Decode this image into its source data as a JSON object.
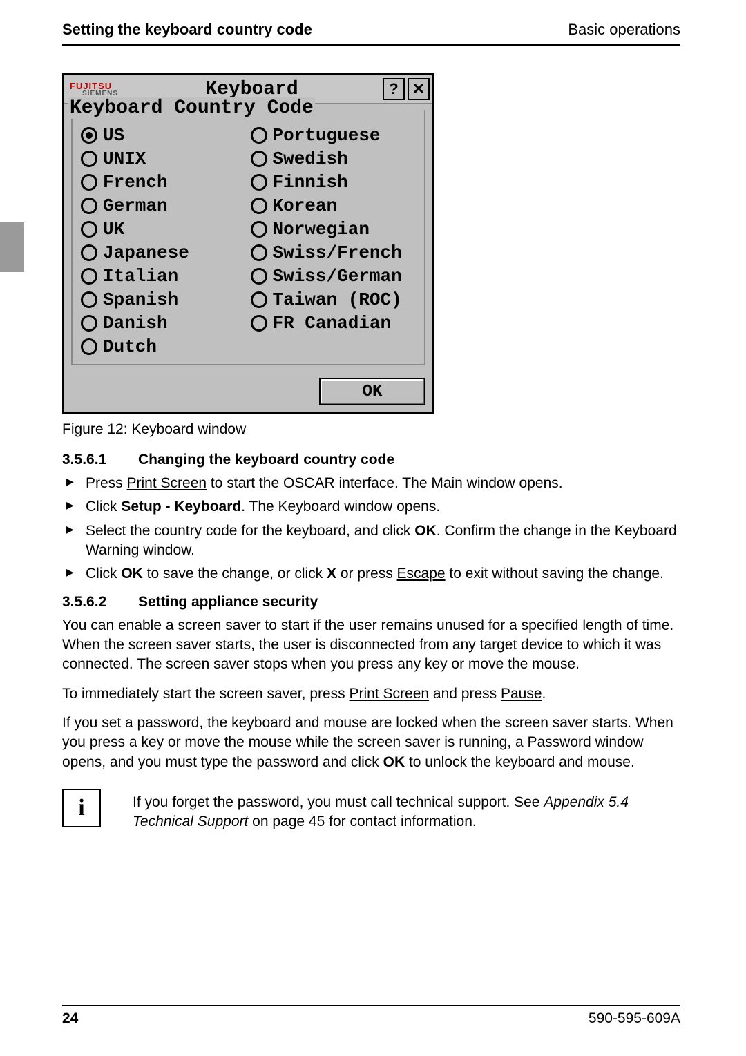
{
  "header": {
    "left": "Setting the keyboard country code",
    "right": "Basic operations"
  },
  "window": {
    "logo_top": "FUJITSU",
    "logo_bot": "SIEMENS",
    "title": "Keyboard",
    "help_btn": "?",
    "close_btn": "✕",
    "group_label": "Keyboard Country Code",
    "col1": [
      {
        "label": "US",
        "checked": true
      },
      {
        "label": "UNIX",
        "checked": false
      },
      {
        "label": "French",
        "checked": false
      },
      {
        "label": "German",
        "checked": false
      },
      {
        "label": "UK",
        "checked": false
      },
      {
        "label": "Japanese",
        "checked": false
      },
      {
        "label": "Italian",
        "checked": false
      },
      {
        "label": "Spanish",
        "checked": false
      },
      {
        "label": "Danish",
        "checked": false
      },
      {
        "label": "Dutch",
        "checked": false
      }
    ],
    "col2": [
      {
        "label": "Portuguese",
        "checked": false
      },
      {
        "label": "Swedish",
        "checked": false
      },
      {
        "label": "Finnish",
        "checked": false
      },
      {
        "label": "Korean",
        "checked": false
      },
      {
        "label": "Norwegian",
        "checked": false
      },
      {
        "label": "Swiss/French",
        "checked": false
      },
      {
        "label": "Swiss/German",
        "checked": false
      },
      {
        "label": "Taiwan (ROC)",
        "checked": false
      },
      {
        "label": "FR Canadian",
        "checked": false
      }
    ],
    "ok": "OK"
  },
  "caption": "Figure 12: Keyboard window",
  "section1": {
    "num": "3.5.6.1",
    "title": "Changing the keyboard country code",
    "steps": {
      "s1a": "Press ",
      "s1b": "Print Screen",
      "s1c": " to start the OSCAR interface. The Main window opens.",
      "s2a": "Click ",
      "s2b": "Setup - Keyboard",
      "s2c": ". The Keyboard window opens.",
      "s3a": "Select the country code for the keyboard, and click ",
      "s3b": "OK",
      "s3c": ". Confirm the change in the Keyboard Warning window.",
      "s4a": "Click ",
      "s4b": "OK",
      "s4c": " to save the change, or click ",
      "s4d": "X",
      "s4e": " or press ",
      "s4f": "Escape",
      "s4g": " to exit without saving the change."
    }
  },
  "section2": {
    "num": "3.5.6.2",
    "title": "Setting appliance security",
    "p1": "You can enable a screen saver to start if the user remains unused for a specified length of time. When the screen saver starts, the user is disconnected from any target device to which it was connected. The screen saver stops when you press any key or move the mouse.",
    "p2a": "To immediately start the screen saver, press ",
    "p2b": "Print Screen",
    "p2c": " and press ",
    "p2d": "Pause",
    "p2e": ".",
    "p3a": "If you set a password, the keyboard and mouse are locked when the screen saver starts. When you press a key or move the mouse while the screen saver is running, a Password window opens, and you must type the password and click ",
    "p3b": "OK",
    "p3c": " to unlock the keyboard and mouse."
  },
  "note": {
    "icon": "i",
    "t1": "If you forget the password, you must call technical support. See ",
    "t2": "Appendix 5.4 Technical Support",
    "t3": " on page 45 for contact information."
  },
  "footer": {
    "left": "24",
    "right": "590-595-609A"
  }
}
